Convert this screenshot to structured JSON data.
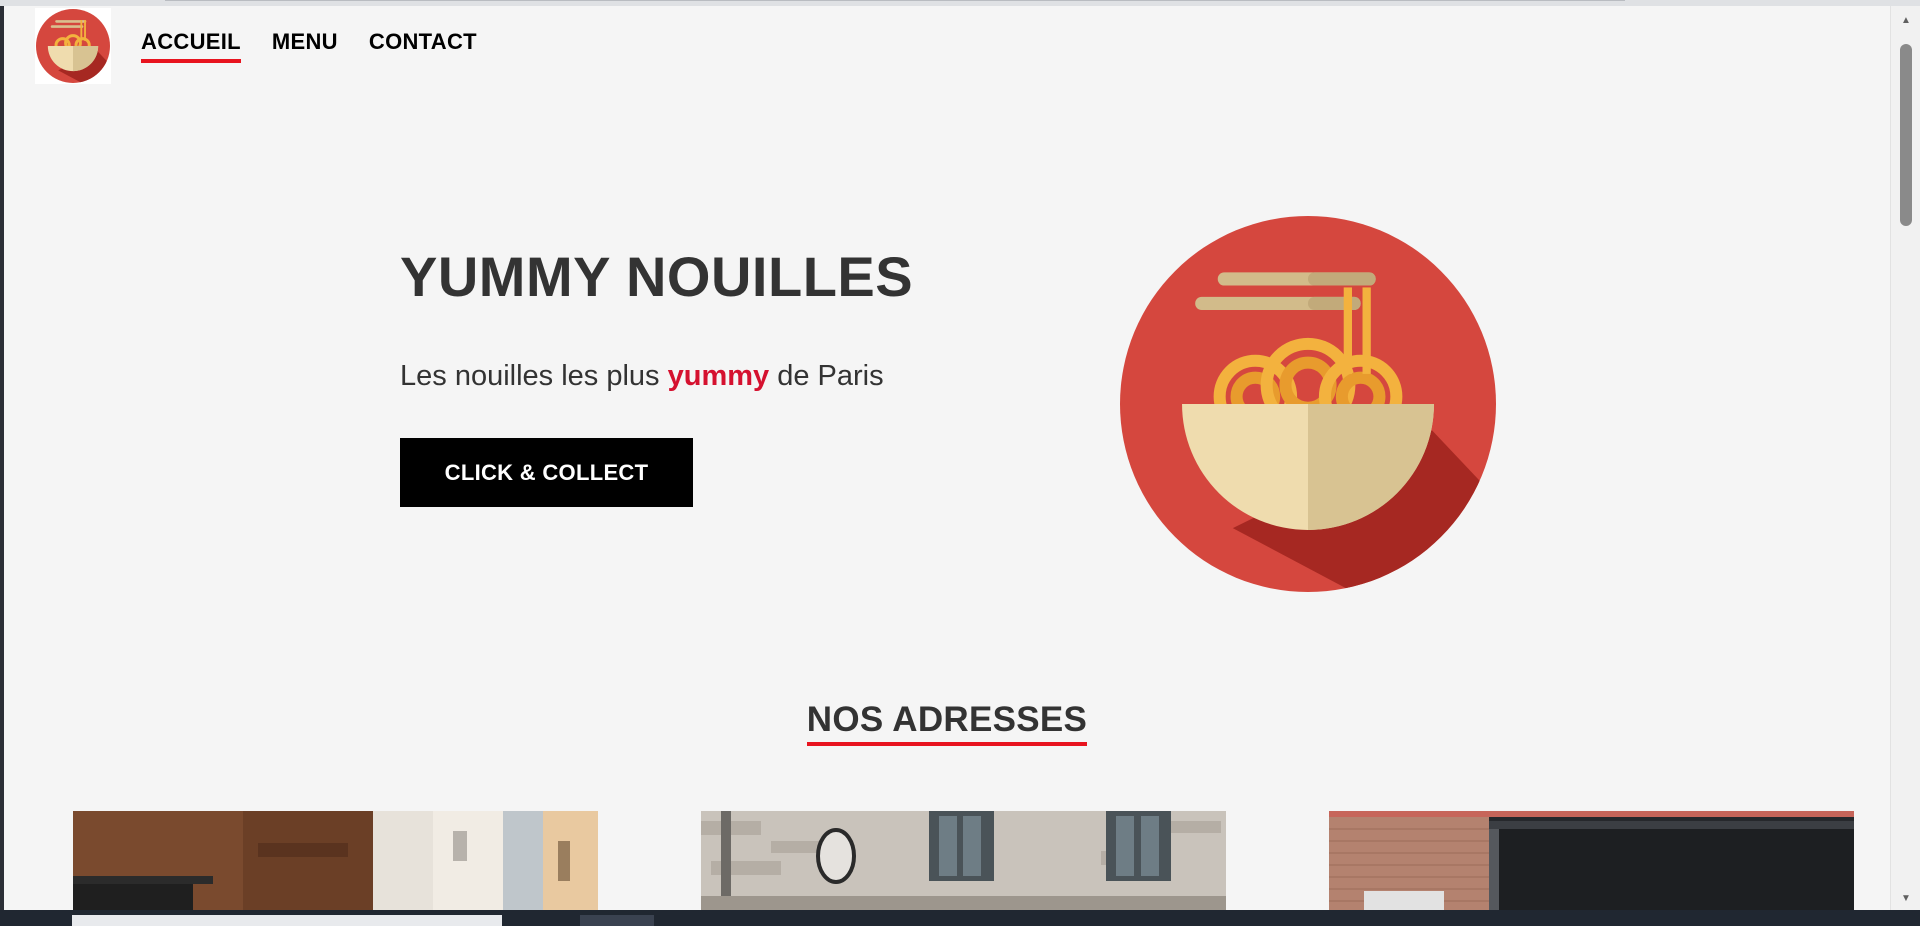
{
  "nav": {
    "logo_icon": "noodle-bowl-icon",
    "links": [
      {
        "label": "ACCUEIL",
        "active": true
      },
      {
        "label": "MENU",
        "active": false
      },
      {
        "label": "CONTACT",
        "active": false
      }
    ]
  },
  "hero": {
    "title": "YUMMY NOUILLES",
    "subtitle_before": "Les nouilles les plus",
    "subtitle_highlight": "yummy",
    "subtitle_after": "de Paris",
    "cta_label": "CLICK & COLLECT",
    "image_icon": "noodle-bowl-icon"
  },
  "addresses": {
    "title": "NOS ADRESSES",
    "cards": [
      {
        "image": "restaurant-facade-wood-street"
      },
      {
        "image": "restaurant-facade-stone-building"
      },
      {
        "image": "restaurant-facade-brick-dark"
      }
    ]
  },
  "colors": {
    "accent_red": "#e8141f",
    "highlight_red": "#d5112f",
    "logo_red": "#d5473e",
    "background": "#f5f5f5",
    "text_dark": "#333333"
  }
}
